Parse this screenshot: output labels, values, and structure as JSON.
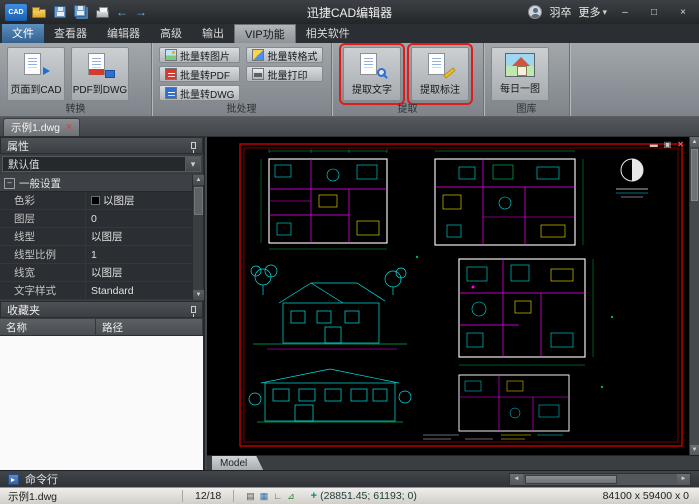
{
  "titlebar": {
    "logo": "CAD",
    "title": "迅捷CAD编辑器",
    "username": "羽卒",
    "more": "更多",
    "undo": "←",
    "redo": "→",
    "minimize": "–",
    "maximize": "□",
    "close": "×"
  },
  "menu": {
    "tabs": [
      "文件",
      "查看器",
      "编辑器",
      "高级",
      "输出",
      "VIP功能",
      "相关软件"
    ],
    "active_tab": "VIP功能"
  },
  "ribbon": {
    "convert": {
      "label": "转换",
      "page_to_cad": "页面到CAD",
      "pdf_to_dwg": "PDF到DWG"
    },
    "batch": {
      "label": "批处理",
      "to_image": "批量转图片",
      "to_format": "批量转格式",
      "to_pdf": "批量转PDF",
      "print": "批量打印",
      "to_dwg": "批量转DWG"
    },
    "extract": {
      "label": "提取",
      "text": "提取文字",
      "dim": "提取标注"
    },
    "gallery": {
      "label": "图库",
      "daily": "每日一图"
    }
  },
  "doc_tab": {
    "name": "示例1.dwg",
    "close": "×"
  },
  "properties": {
    "title": "属性",
    "preset": "默认值",
    "section": "一般设置",
    "rows": [
      {
        "label": "色彩",
        "value": "以图层",
        "swatch": "#000000"
      },
      {
        "label": "图层",
        "value": "0"
      },
      {
        "label": "线型",
        "value": "以图层"
      },
      {
        "label": "线型比例",
        "value": "1"
      },
      {
        "label": "线宽",
        "value": "以图层"
      },
      {
        "label": "文字样式",
        "value": "Standard"
      }
    ]
  },
  "favorites": {
    "title": "收藏夹",
    "columns": [
      "名称",
      "路径"
    ]
  },
  "commandbar": {
    "label": "命令行"
  },
  "canvas": {
    "model_tab": "Model",
    "min": "▬",
    "restore": "▣",
    "close": "✕"
  },
  "statusbar": {
    "filename": "示例1.dwg",
    "page": "12/18",
    "icons": [
      "▤",
      "▦",
      "∟",
      "⊿"
    ],
    "crosshair": "+",
    "coordinates": "(28851.45; 61193; 0)",
    "size": "84100 x 59400 x 0"
  },
  "colors": {
    "annotation_red": "#e01b1b",
    "drawing_border": "#c80000",
    "walls": "#f0f0f0",
    "interior_lines": "#ff00ff",
    "fixtures": "#00e5e5",
    "dimensions": "#00b050",
    "highlights": "#ffe600",
    "canvas_bg": "#000000"
  }
}
